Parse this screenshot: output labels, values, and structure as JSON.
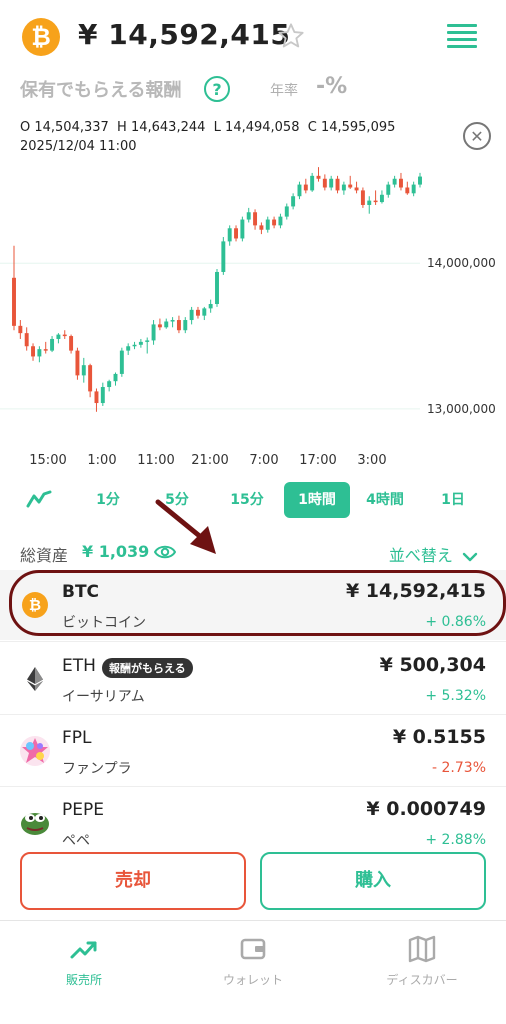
{
  "header": {
    "coin_symbol_glyph": "₿",
    "price": "¥ 14,592,415"
  },
  "reward": {
    "label": "保有でもらえる報酬",
    "help": "?",
    "annual_label": "年率",
    "annual_value": "-%"
  },
  "ohlc": {
    "line1": "O 14,504,337  H 14,643,244  L 14,494,058  C 14,595,095",
    "line2": "2025/12/04 11:00"
  },
  "chart_data": {
    "type": "candlestick",
    "x_tick_labels": [
      "15:00",
      "1:00",
      "11:00",
      "21:00",
      "7:00",
      "17:00",
      "3:00"
    ],
    "y_tick_labels": [
      "14,000,000",
      "13,000,000"
    ],
    "y_ticks": [
      14000000,
      13000000
    ],
    "ylim": [
      12800000,
      14750000
    ],
    "up_color": "#2ebf94",
    "down_color": "#e8553a",
    "candles": [
      [
        13900000,
        14120000,
        13540000,
        13570000
      ],
      [
        13570000,
        13610000,
        13480000,
        13520000
      ],
      [
        13520000,
        13560000,
        13400000,
        13430000
      ],
      [
        13430000,
        13450000,
        13330000,
        13360000
      ],
      [
        13360000,
        13430000,
        13320000,
        13410000
      ],
      [
        13410000,
        13460000,
        13380000,
        13400000
      ],
      [
        13400000,
        13500000,
        13390000,
        13480000
      ],
      [
        13480000,
        13520000,
        13450000,
        13510000
      ],
      [
        13510000,
        13540000,
        13480000,
        13500000
      ],
      [
        13500000,
        13510000,
        13380000,
        13400000
      ],
      [
        13400000,
        13420000,
        13200000,
        13230000
      ],
      [
        13230000,
        13350000,
        13180000,
        13300000
      ],
      [
        13300000,
        13310000,
        13080000,
        13120000
      ],
      [
        13120000,
        13140000,
        12980000,
        13040000
      ],
      [
        13040000,
        13180000,
        13020000,
        13150000
      ],
      [
        13150000,
        13200000,
        13120000,
        13190000
      ],
      [
        13190000,
        13250000,
        13160000,
        13240000
      ],
      [
        13240000,
        13420000,
        13220000,
        13400000
      ],
      [
        13400000,
        13450000,
        13370000,
        13430000
      ],
      [
        13430000,
        13460000,
        13410000,
        13440000
      ],
      [
        13440000,
        13480000,
        13420000,
        13460000
      ],
      [
        13460000,
        13490000,
        13380000,
        13470000
      ],
      [
        13470000,
        13610000,
        13440000,
        13580000
      ],
      [
        13580000,
        13620000,
        13540000,
        13560000
      ],
      [
        13560000,
        13620000,
        13550000,
        13600000
      ],
      [
        13600000,
        13630000,
        13560000,
        13610000
      ],
      [
        13610000,
        13640000,
        13520000,
        13540000
      ],
      [
        13540000,
        13630000,
        13520000,
        13610000
      ],
      [
        13610000,
        13700000,
        13580000,
        13680000
      ],
      [
        13680000,
        13700000,
        13620000,
        13640000
      ],
      [
        13640000,
        13700000,
        13610000,
        13690000
      ],
      [
        13690000,
        13750000,
        13660000,
        13720000
      ],
      [
        13720000,
        13960000,
        13700000,
        13940000
      ],
      [
        13940000,
        14180000,
        13920000,
        14150000
      ],
      [
        14150000,
        14260000,
        14120000,
        14240000
      ],
      [
        14240000,
        14260000,
        14150000,
        14170000
      ],
      [
        14170000,
        14320000,
        14150000,
        14300000
      ],
      [
        14300000,
        14380000,
        14280000,
        14350000
      ],
      [
        14350000,
        14370000,
        14230000,
        14260000
      ],
      [
        14260000,
        14280000,
        14200000,
        14230000
      ],
      [
        14230000,
        14320000,
        14210000,
        14300000
      ],
      [
        14300000,
        14320000,
        14240000,
        14260000
      ],
      [
        14260000,
        14340000,
        14240000,
        14320000
      ],
      [
        14320000,
        14410000,
        14300000,
        14390000
      ],
      [
        14390000,
        14480000,
        14370000,
        14460000
      ],
      [
        14460000,
        14560000,
        14440000,
        14540000
      ],
      [
        14540000,
        14580000,
        14480000,
        14500000
      ],
      [
        14500000,
        14620000,
        14490000,
        14600000
      ],
      [
        14600000,
        14660000,
        14560000,
        14580000
      ],
      [
        14580000,
        14610000,
        14500000,
        14520000
      ],
      [
        14520000,
        14600000,
        14500000,
        14580000
      ],
      [
        14580000,
        14600000,
        14480000,
        14500000
      ],
      [
        14500000,
        14560000,
        14470000,
        14540000
      ],
      [
        14540000,
        14600000,
        14510000,
        14520000
      ],
      [
        14520000,
        14560000,
        14480000,
        14500000
      ],
      [
        14500000,
        14520000,
        14380000,
        14400000
      ],
      [
        14400000,
        14460000,
        14340000,
        14430000
      ],
      [
        14430000,
        14500000,
        14400000,
        14420000
      ],
      [
        14420000,
        14500000,
        14410000,
        14470000
      ],
      [
        14470000,
        14560000,
        14450000,
        14540000
      ],
      [
        14540000,
        14600000,
        14520000,
        14580000
      ],
      [
        14580000,
        14620000,
        14500000,
        14520000
      ],
      [
        14520000,
        14560000,
        14470000,
        14480000
      ],
      [
        14480000,
        14560000,
        14460000,
        14540000
      ],
      [
        14540000,
        14620000,
        14520000,
        14595095
      ]
    ]
  },
  "intervals": [
    "1分",
    "5分",
    "15分",
    "1時間",
    "4時間",
    "1日"
  ],
  "active_interval": "1時間",
  "assets": {
    "label": "総資産",
    "value": "¥ 1,039",
    "sort_label": "並べ替え"
  },
  "coins": [
    {
      "symbol": "BTC",
      "name": "ビットコイン",
      "price": "¥ 14,592,415",
      "change": "+ 0.86%",
      "direction": "up"
    },
    {
      "symbol": "ETH",
      "name": "イーサリアム",
      "price": "¥ 500,304",
      "change": "+ 5.32%",
      "direction": "up",
      "badge": "報酬がもらえる"
    },
    {
      "symbol": "FPL",
      "name": "ファンプラ",
      "price": "¥ 0.5155",
      "change": "- 2.73%",
      "direction": "down"
    },
    {
      "symbol": "PEPE",
      "name": "ペペ",
      "price": "¥ 0.000749",
      "change": "+ 2.88%",
      "direction": "up"
    }
  ],
  "actions": {
    "sell": "売却",
    "buy": "購入"
  },
  "nav": [
    {
      "label": "販売所",
      "icon": "trend-up-icon",
      "active": true
    },
    {
      "label": "ウォレット",
      "icon": "wallet-icon",
      "active": false
    },
    {
      "label": "ディスカバー",
      "icon": "map-icon",
      "active": false
    }
  ],
  "colors": {
    "accent": "#2ebf94",
    "down": "#e8553a",
    "highlight_border": "#6e1212",
    "btc_orange": "#f7a21b"
  }
}
